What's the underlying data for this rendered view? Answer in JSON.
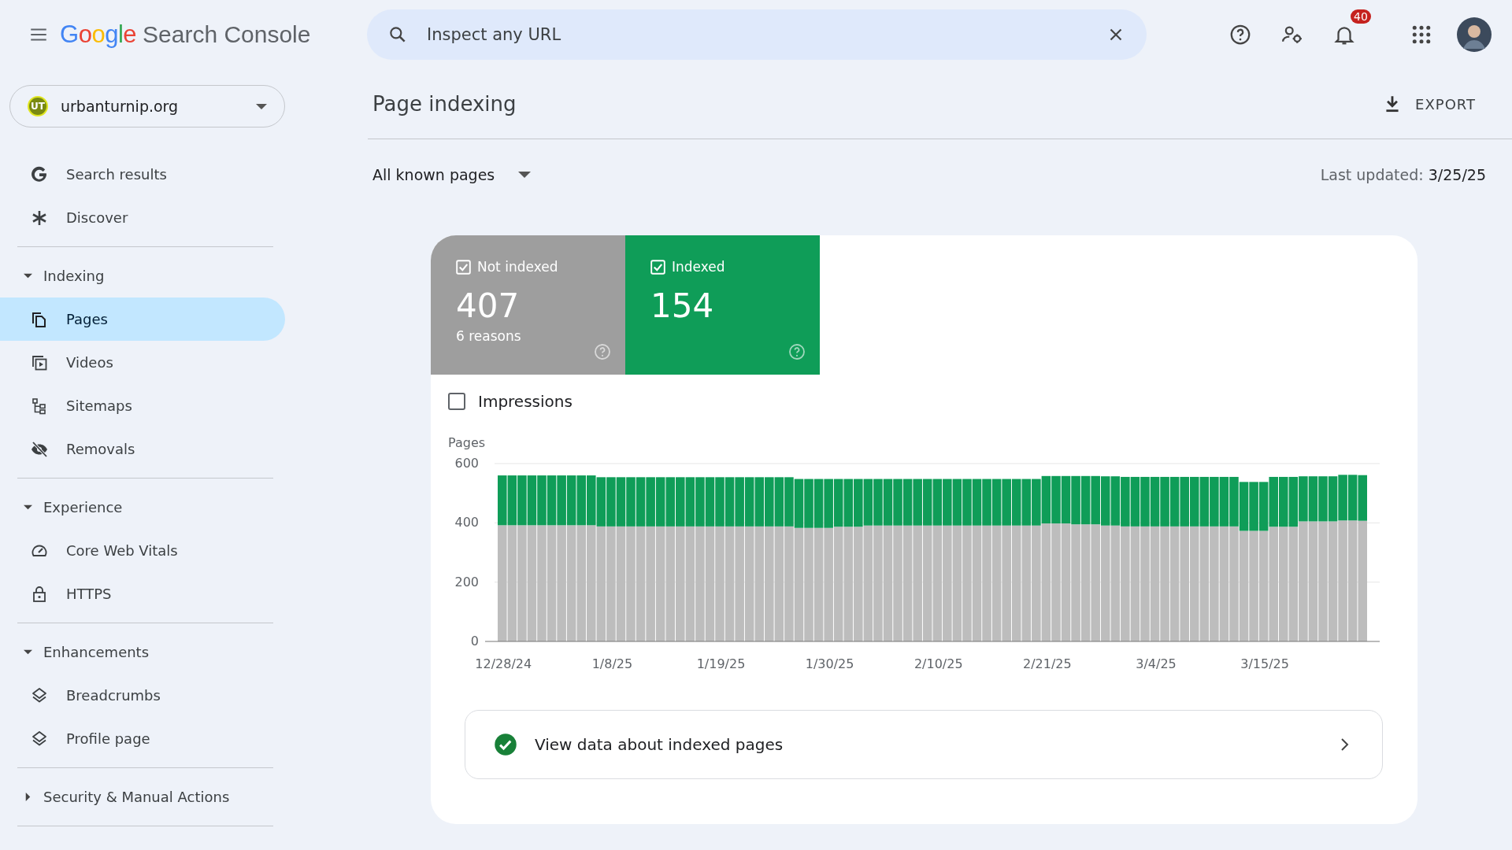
{
  "header": {
    "logo": "Google",
    "product": "Search Console",
    "search": {
      "placeholder": "Inspect any URL"
    },
    "notifications": "40"
  },
  "sidebar": {
    "property": "urbanturnip.org",
    "property_initials": "UT",
    "items": [
      {
        "label": "Search results",
        "selected": false
      },
      {
        "label": "Discover",
        "selected": false
      }
    ],
    "sections": [
      {
        "title": "Indexing",
        "expanded": true,
        "items": [
          {
            "label": "Pages",
            "selected": true
          },
          {
            "label": "Videos",
            "selected": false
          },
          {
            "label": "Sitemaps",
            "selected": false
          },
          {
            "label": "Removals",
            "selected": false
          }
        ]
      },
      {
        "title": "Experience",
        "expanded": true,
        "items": [
          {
            "label": "Core Web Vitals",
            "selected": false
          },
          {
            "label": "HTTPS",
            "selected": false
          }
        ]
      },
      {
        "title": "Enhancements",
        "expanded": true,
        "items": [
          {
            "label": "Breadcrumbs",
            "selected": false
          },
          {
            "label": "Profile page",
            "selected": false
          }
        ]
      },
      {
        "title": "Security & Manual Actions",
        "expanded": false
      }
    ]
  },
  "page": {
    "title": "Page indexing",
    "export": "EXPORT",
    "filter": "All known pages",
    "last_updated_label": "Last updated:",
    "last_updated": "3/25/25",
    "tiles": [
      {
        "value": "407",
        "sub": "6 reasons",
        "selected": true,
        "color": "#9e9e9e"
      },
      {
        "value": "154",
        "selected": true,
        "color": "#0f9d58"
      }
    ],
    "impressions": {
      "label": "Impressions",
      "checked": false
    },
    "chart_data": {
      "type": "bar",
      "ylabel": "Pages",
      "stacked": true,
      "ylim": [
        0,
        600
      ],
      "yticks": [
        0,
        200,
        400,
        600
      ],
      "categories": [
        "12/28/24",
        null,
        null,
        null,
        null,
        null,
        null,
        null,
        null,
        null,
        null,
        "1/8/25",
        null,
        null,
        null,
        null,
        null,
        null,
        null,
        null,
        null,
        null,
        "1/19/25",
        null,
        null,
        null,
        null,
        null,
        null,
        null,
        null,
        null,
        null,
        "1/30/25",
        null,
        null,
        null,
        null,
        null,
        null,
        null,
        null,
        null,
        null,
        "2/10/25",
        null,
        null,
        null,
        null,
        null,
        null,
        null,
        null,
        null,
        null,
        "2/21/25",
        null,
        null,
        null,
        null,
        null,
        null,
        null,
        null,
        null,
        null,
        "3/4/25",
        null,
        null,
        null,
        null,
        null,
        null,
        null,
        null,
        null,
        null,
        "3/15/25",
        null,
        null,
        null,
        null,
        null,
        null,
        null,
        null,
        null,
        null
      ],
      "series": [
        {
          "name": "Not indexed",
          "color": "#bdbdbd",
          "values": [
            392,
            392,
            392,
            392,
            392,
            392,
            392,
            392,
            392,
            392,
            388,
            388,
            388,
            388,
            388,
            388,
            388,
            388,
            388,
            388,
            388,
            388,
            388,
            388,
            388,
            388,
            388,
            388,
            388,
            388,
            383,
            383,
            383,
            383,
            387,
            387,
            387,
            391,
            391,
            391,
            391,
            391,
            391,
            391,
            391,
            391,
            391,
            391,
            391,
            391,
            391,
            391,
            391,
            391,
            391,
            398,
            398,
            398,
            395,
            395,
            395,
            391,
            391,
            388,
            388,
            388,
            388,
            388,
            388,
            388,
            388,
            388,
            388,
            388,
            388,
            373,
            373,
            373,
            387,
            387,
            387,
            405,
            405,
            405,
            405,
            408,
            408,
            407
          ]
        },
        {
          "name": "Indexed",
          "color": "#0f9d58",
          "values": [
            168,
            168,
            168,
            168,
            168,
            168,
            168,
            168,
            168,
            168,
            166,
            166,
            166,
            166,
            166,
            166,
            166,
            166,
            166,
            166,
            166,
            166,
            166,
            166,
            166,
            166,
            166,
            166,
            166,
            166,
            165,
            165,
            165,
            165,
            161,
            161,
            161,
            157,
            157,
            157,
            157,
            157,
            157,
            157,
            157,
            157,
            157,
            157,
            157,
            157,
            157,
            157,
            157,
            157,
            157,
            160,
            160,
            160,
            163,
            163,
            163,
            166,
            166,
            167,
            167,
            167,
            167,
            167,
            167,
            167,
            167,
            167,
            167,
            167,
            167,
            165,
            165,
            165,
            168,
            168,
            168,
            152,
            152,
            152,
            152,
            154,
            154,
            154
          ]
        }
      ]
    },
    "view_data": "View data about indexed pages"
  }
}
